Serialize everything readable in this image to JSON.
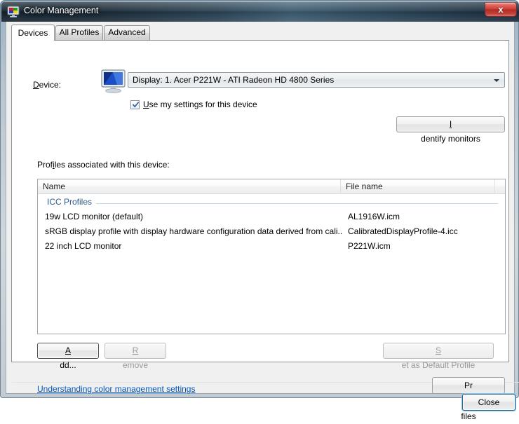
{
  "window": {
    "title": "Color Management",
    "icon": "color-monitor-icon",
    "close_label": "x"
  },
  "tabs": [
    {
      "label": "Devices",
      "selected": true
    },
    {
      "label": "All Profiles",
      "selected": false
    },
    {
      "label": "Advanced",
      "selected": false
    }
  ],
  "device_section": {
    "label": "Device:",
    "icon": "display-monitor-icon",
    "combo_value": "Display: 1. Acer P221W - ATI Radeon HD 4800 Series",
    "checkbox": {
      "label": "Use my settings for this device",
      "checked": true
    },
    "identify_button": "Identify monitors"
  },
  "profiles_section": {
    "label": "Profiles associated with this device:",
    "columns": [
      "Name",
      "File name"
    ],
    "group_label": "ICC Profiles",
    "rows": [
      {
        "name": "19w LCD monitor (default)",
        "file": "AL1916W.icm"
      },
      {
        "name": "sRGB display profile with display hardware configuration data derived from cali...",
        "file": "CalibratedDisplayProfile-4.icc"
      },
      {
        "name": "22 inch LCD monitor",
        "file": "P221W.icm"
      }
    ],
    "buttons": {
      "add": "Add...",
      "remove": "Remove",
      "set_default": "Set as Default Profile"
    }
  },
  "footer": {
    "help_link": "Understanding color management settings",
    "profiles_button": "Profiles",
    "close_button": "Close"
  },
  "colors": {
    "link": "#0055bb",
    "group_header": "#2e5c8a",
    "titlebar": "#1b2c39",
    "close_button": "#c9392f"
  }
}
